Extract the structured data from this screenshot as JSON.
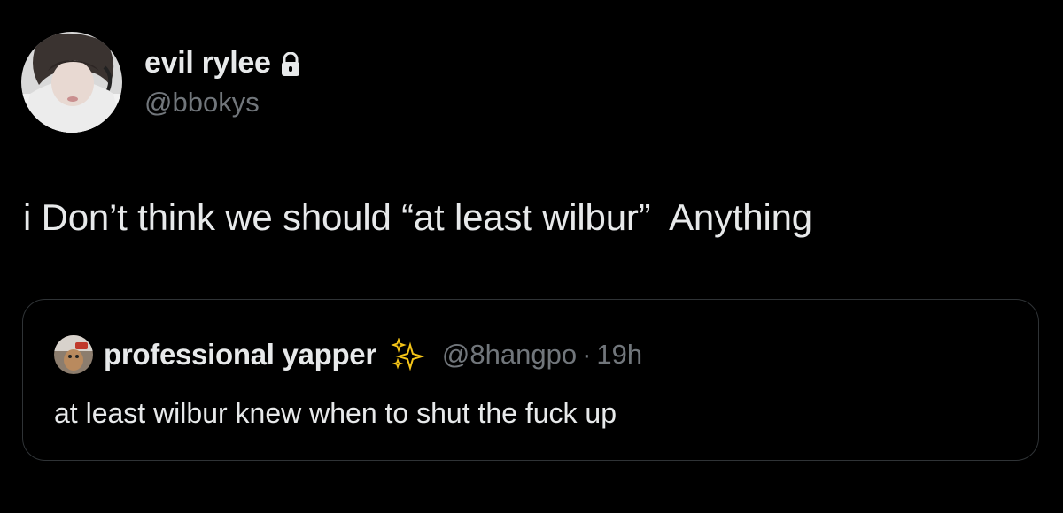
{
  "author": {
    "display_name": "evil rylee",
    "handle": "@bbokys",
    "protected_icon": "lock-icon",
    "avatar_icon": "profile-photo"
  },
  "tweet": {
    "text": "i Don’t think we should “at least wilbur”  Anything"
  },
  "quoted": {
    "display_name": "professional yapper",
    "emoji_icon": "sparkles-icon",
    "handle": "@8hangpo",
    "separator": "·",
    "time": "19h",
    "text": "at least wilbur knew when to shut the fuck up"
  },
  "colors": {
    "background": "#000000",
    "primary_text": "#e7e9ea",
    "secondary_text": "#71767b",
    "border": "#2f3336",
    "sparkle": "#f5c518"
  }
}
